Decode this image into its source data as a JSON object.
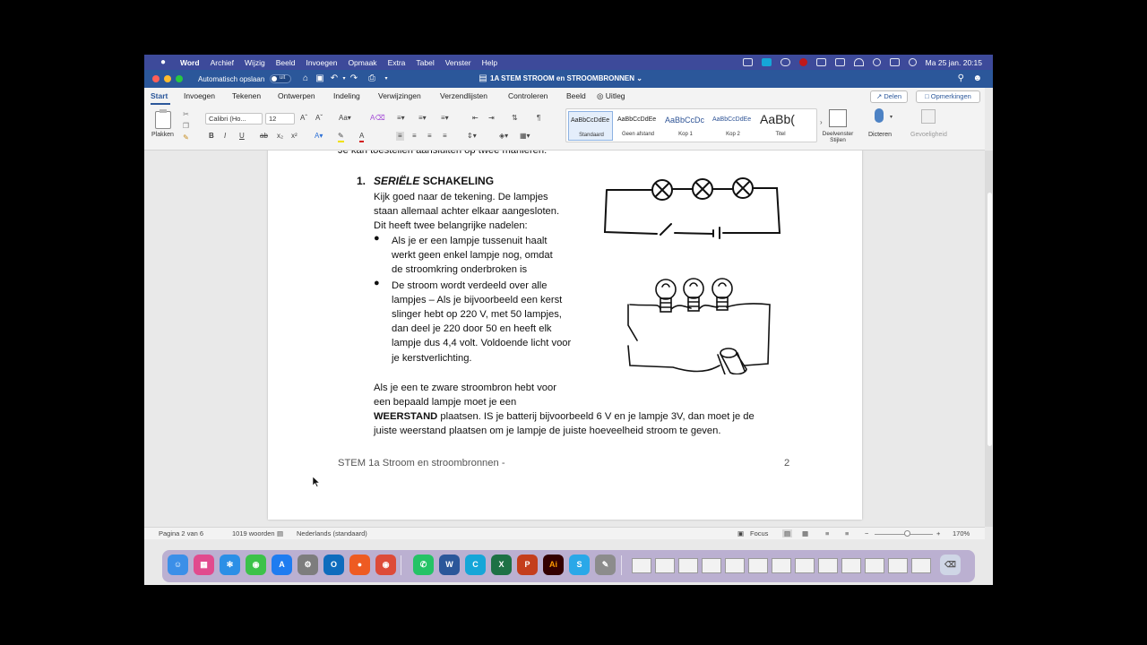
{
  "menubar": {
    "app_name": "Word",
    "items": [
      "Archief",
      "Wijzig",
      "Beeld",
      "Invoegen",
      "Opmaak",
      "Extra",
      "Tabel",
      "Venster",
      "Help"
    ],
    "clock": "Ma 25 jan.  20:15"
  },
  "titlebar": {
    "autosave_label": "Automatisch opslaan",
    "autosave_state": "uit",
    "doc_title": "1A STEM STROOM en STROOMBRONNEN"
  },
  "ribbon": {
    "tabs": [
      "Start",
      "Invoegen",
      "Tekenen",
      "Ontwerpen",
      "Indeling",
      "Verwijzingen",
      "Verzendlijsten",
      "Controleren",
      "Beeld",
      "Uitleg"
    ],
    "share_label": "Delen",
    "comments_label": "Opmerkingen",
    "paste_label": "Plakken",
    "font_name": "Calibri (Ho...",
    "font_size": "12",
    "styles": [
      {
        "sample": "AaBbCcDdEe",
        "name": "Standaard"
      },
      {
        "sample": "AaBbCcDdEe",
        "name": "Geen afstand"
      },
      {
        "sample": "AaBbCcDc",
        "name": "Kop 1"
      },
      {
        "sample": "AaBbCcDdEe",
        "name": "Kop 2"
      },
      {
        "sample": "AaBb(",
        "name": "Titel"
      }
    ],
    "styles_pane_label": "Deelvenster Stijlen",
    "dictate_label": "Dicteren",
    "security_label": "Gevoeligheid"
  },
  "document": {
    "cut_line": "Je kan toestellen aansluiten op twee manieren:",
    "heading_number": "1.",
    "heading_italic": "SERIËLE",
    "heading_rest": " SCHAKELING",
    "intro_lines": [
      "Kijk goed naar de tekening. De lampjes",
      "staan allemaal achter elkaar aangesloten.",
      "Dit heeft twee belangrijke nadelen:"
    ],
    "bullet1_lines": [
      "Als je er een lampje tussenuit haalt",
      "werkt geen enkel lampje nog, omdat",
      "de stroomkring onderbroken is"
    ],
    "bullet2_lines": [
      "De stroom wordt verdeeld over alle",
      "lampjes – Als je bijvoorbeeld een kerst",
      "slinger hebt op 220 V, met 50 lampjes,",
      "dan deel je 220 door 50 en heeft elk",
      "lampje dus 4,4 volt. Voldoende licht voor",
      "je kerstverlichting."
    ],
    "para_lines": [
      "Als je een te zware stroombron hebt voor",
      "een bepaald lampje moet je een"
    ],
    "para_bold": "WEERSTAND",
    "para_rest": " plaatsen. IS je batterij bijvoorbeeld 6 V en je lampje 3V, dan moet je de",
    "para_last": "juiste weerstand plaatsen om je lampje de juiste hoeveelheid stroom te geven.",
    "footer_left": "STEM 1a  Stroom en stroombronnen -",
    "footer_right": "2"
  },
  "statusbar": {
    "page": "Pagina 2 van 6",
    "words": "1019 woorden",
    "language": "Nederlands (standaard)",
    "focus": "Focus",
    "zoom": "170%"
  },
  "colors": {
    "menubar": "#3d4a9a",
    "word_blue": "#2b579a"
  }
}
